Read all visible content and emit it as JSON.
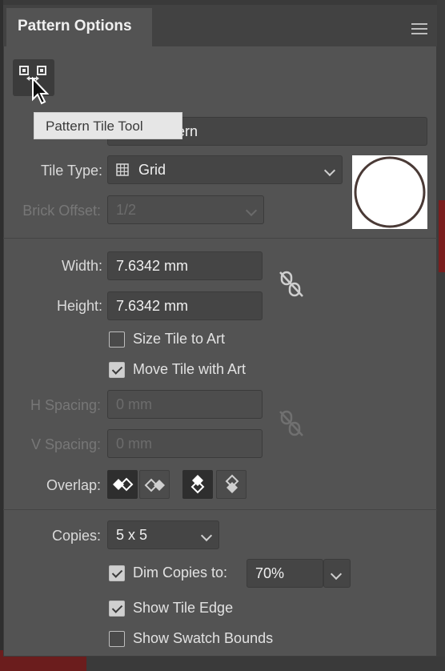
{
  "panel": {
    "title": "Pattern Options"
  },
  "tooltip": {
    "text": "Pattern Tile Tool"
  },
  "name_field": {
    "visible_value": "ern"
  },
  "tile_type": {
    "label": "Tile Type:",
    "value": "Grid",
    "icon": "grid-icon"
  },
  "brick_offset": {
    "label": "Brick Offset:",
    "value": "1/2"
  },
  "width": {
    "label": "Width:",
    "value": "7.6342 mm"
  },
  "height": {
    "label": "Height:",
    "value": "7.6342 mm"
  },
  "size_tile_to_art": {
    "label": "Size Tile to Art",
    "checked": false
  },
  "move_tile_with_art": {
    "label": "Move Tile with Art",
    "checked": true
  },
  "h_spacing": {
    "label": "H Spacing:",
    "value": "0 mm"
  },
  "v_spacing": {
    "label": "V Spacing:",
    "value": "0 mm"
  },
  "overlap": {
    "label": "Overlap:"
  },
  "copies": {
    "label": "Copies:",
    "value": "5 x 5"
  },
  "dim_copies": {
    "label": "Dim Copies to:",
    "checked": true,
    "value": "70%"
  },
  "show_tile_edge": {
    "label": "Show Tile Edge",
    "checked": true
  },
  "show_swatch_bounds": {
    "label": "Show Swatch Bounds",
    "checked": false
  },
  "colors": {
    "panel_bg": "#535353",
    "field_bg": "#454545",
    "preview_circle": "#4a3a36"
  }
}
